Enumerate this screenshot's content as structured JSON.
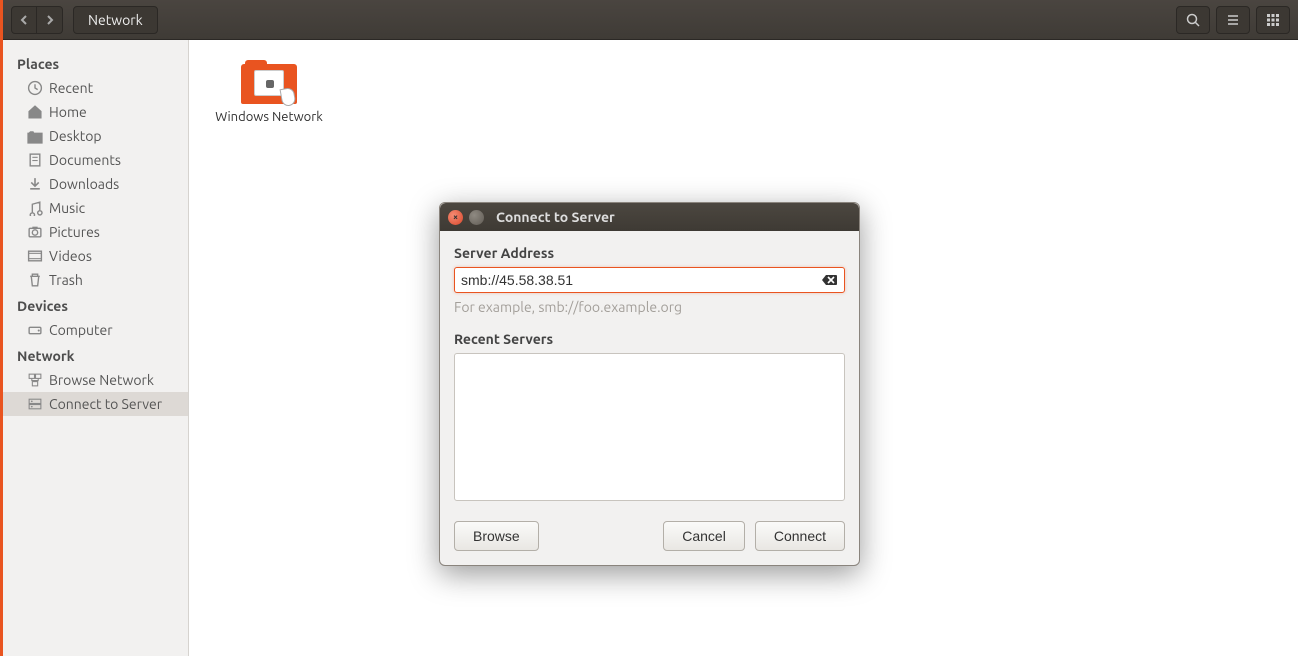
{
  "toolbar": {
    "path_label": "Network"
  },
  "sidebar": {
    "headings": {
      "places": "Places",
      "devices": "Devices",
      "network": "Network"
    },
    "places": [
      {
        "label": "Recent"
      },
      {
        "label": "Home"
      },
      {
        "label": "Desktop"
      },
      {
        "label": "Documents"
      },
      {
        "label": "Downloads"
      },
      {
        "label": "Music"
      },
      {
        "label": "Pictures"
      },
      {
        "label": "Videos"
      },
      {
        "label": "Trash"
      }
    ],
    "devices": [
      {
        "label": "Computer"
      }
    ],
    "network": [
      {
        "label": "Browse Network"
      },
      {
        "label": "Connect to Server"
      }
    ]
  },
  "main": {
    "folder_label": "Windows Network"
  },
  "dialog": {
    "title": "Connect to Server",
    "address_label": "Server Address",
    "address_value": "smb://45.58.38.51",
    "hint": "For example, smb://foo.example.org",
    "recent_label": "Recent Servers",
    "browse_btn": "Browse",
    "cancel_btn": "Cancel",
    "connect_btn": "Connect"
  }
}
